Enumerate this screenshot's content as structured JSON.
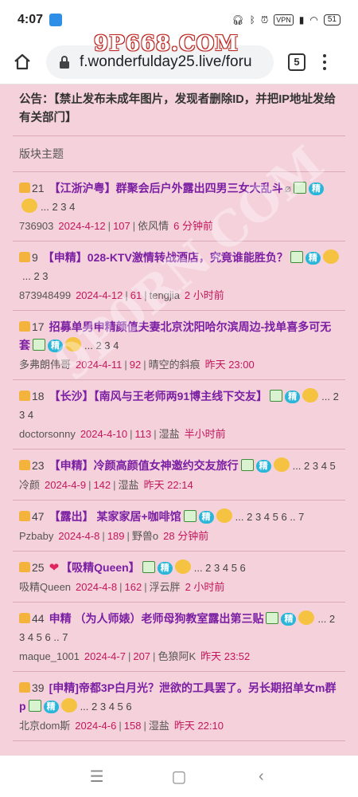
{
  "status_bar": {
    "time": "4:07",
    "vpn": "VPN",
    "battery": "51"
  },
  "browser": {
    "url": "f.wonderfulday25.live/foru",
    "tab_count": "5",
    "logo_text": "9P668.COM"
  },
  "watermark": "9P0RN.COM",
  "notice": "公告：【禁止发布未成年图片，发现者删除ID，并把IP地址发给有关部门】",
  "section_title": "版块主题",
  "threads": [
    {
      "likes": "21",
      "heart": false,
      "title": "【江浙沪粤】群聚会后户外露出四男三女大乱斗",
      "pages": "... 2 3 4",
      "author": "736903",
      "date": "2024-4-12",
      "replies": "107",
      "last_user": "依风情",
      "last_time": "6 分钟前"
    },
    {
      "likes": "9",
      "heart": false,
      "title": "【申精】028-KTV激情转战酒店，究竟谁能胜负？",
      "pages": "... 2 3",
      "author": "873948499",
      "date": "2024-4-12",
      "replies": "61",
      "last_user": "tengjia",
      "last_time": "2 小时前"
    },
    {
      "likes": "17",
      "heart": false,
      "title": "招募单男申精颜值夫妻北京沈阳哈尔滨周边-找单喜多可无套",
      "pages": "... 2 3 4",
      "author": "多弗朗伟哥",
      "date": "2024-4-11",
      "replies": "92",
      "last_user": "晴空的斜痕",
      "last_time": "昨天 23:00"
    },
    {
      "likes": "18",
      "heart": false,
      "title": "【长沙】【南风与王老师两91博主线下交友】",
      "pages": "... 2 3 4",
      "author": "doctorsonny",
      "date": "2024-4-10",
      "replies": "113",
      "last_user": "湿盐",
      "last_time": "半小时前"
    },
    {
      "likes": "23",
      "heart": false,
      "title": "【申精】冷颜高颜值女神邀约交友旅行",
      "pages": "... 2 3 4 5",
      "author": "冷颜",
      "date": "2024-4-9",
      "replies": "142",
      "last_user": "湿盐",
      "last_time": "昨天 22:14"
    },
    {
      "likes": "47",
      "heart": false,
      "title": "【露出】 某家家居+咖啡馆",
      "pages": "... 2 3 4 5 6 .. 7",
      "author": "Pzbaby",
      "date": "2024-4-8",
      "replies": "189",
      "last_user": "野兽o",
      "last_time": "28 分钟前"
    },
    {
      "likes": "25",
      "heart": true,
      "title": "【吸精Queen】",
      "pages": "... 2 3 4 5 6",
      "author": "吸精Queen",
      "date": "2024-4-8",
      "replies": "162",
      "last_user": "浮云胖",
      "last_time": "2 小时前"
    },
    {
      "likes": "44",
      "heart": false,
      "title": "申精 （为人师婊）老师母狗教室露出第三贴",
      "pages": "... 2 3 4 5 6 .. 7",
      "author": "maque_1001",
      "date": "2024-4-7",
      "replies": "207",
      "last_user": "色狼阿K",
      "last_time": "昨天 23:52"
    },
    {
      "likes": "39",
      "heart": false,
      "title": "[申精]帝都3P白月光？泄欲的工具罢了。另长期招单女m群p",
      "pages": "... 2 3 4 5 6",
      "author": "北京dom斯",
      "date": "2024-4-6",
      "replies": "158",
      "last_user": "湿盐",
      "last_time": "昨天 22:10"
    }
  ],
  "badge_label": "精",
  "nav_buttons": {
    "menu": "☰",
    "home": "▢",
    "back": "‹"
  }
}
